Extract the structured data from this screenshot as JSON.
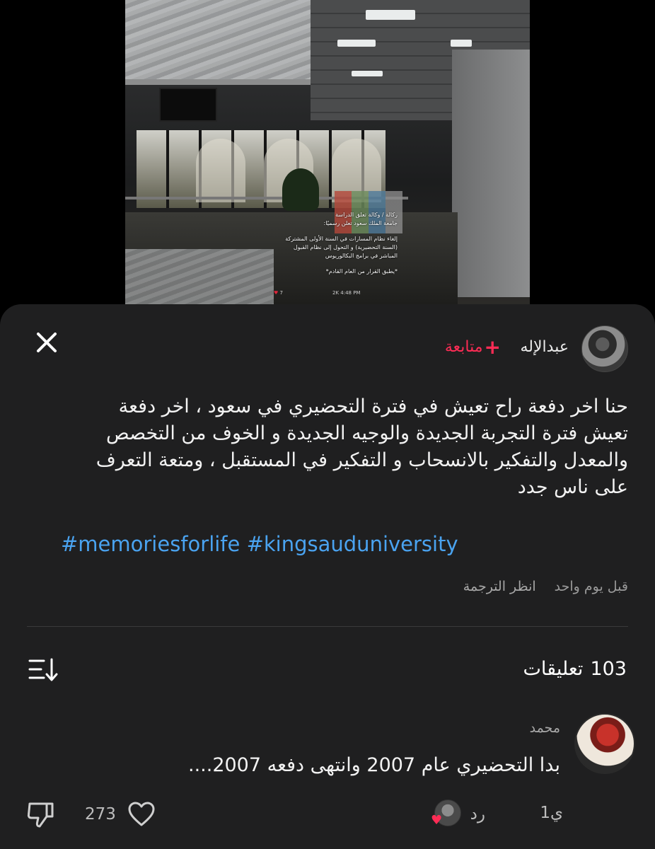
{
  "media": {
    "overlay_lines": [
      "ركالة / وكالة تعلق الدراسة",
      "جامعة الملك سعود  تعلن رسميًا:",
      "",
      "إلغاء نظام المسارات في السنة الأولى المشتركة",
      "(السنة التحضيرية) و التحول إلى نظام القبول",
      "المباشر في برامج البكالوريوس",
      "",
      "*يطبق القرار من العام القادم*"
    ],
    "meta_likes": "7",
    "meta_time": "2K 4:48 PM"
  },
  "post": {
    "username": "عبدالإله",
    "follow_label": "متابعة",
    "follow_plus": "+",
    "caption_lines": [
      "حنا اخر دفعة راح تعيش في فترة التحضيري في سعود ، اخر دفعة",
      "تعيش فترة التجربة الجديدة والوجيه الجديدة و الخوف من التخصص",
      "والمعدل والتفكير بالانسحاب و  التفكير في المستقبل ، ومتعة التعرف",
      "على ناس جدد"
    ],
    "hashtags": [
      "#memoriesforlife",
      "#kingsauduniversity"
    ],
    "posted_time": "قبل يوم واحد",
    "translate_label": "انظر الترجمة"
  },
  "comments": {
    "count": "103",
    "count_label": "تعليقات",
    "items": [
      {
        "author": "محمد",
        "text": "بدا التحضيري عام 2007 وانتهى دفعه 2007....",
        "time": "1ي",
        "reply_label": "رد",
        "likes": "273"
      }
    ]
  },
  "colors": {
    "sheet_bg": "#1f1f20",
    "follow": "#fe2c55",
    "hashtag": "#4aa3f0",
    "muted": "#9a9a9a"
  },
  "icons": [
    "close-icon",
    "plus-icon",
    "sort-icon",
    "dislike-icon",
    "heart-icon"
  ]
}
